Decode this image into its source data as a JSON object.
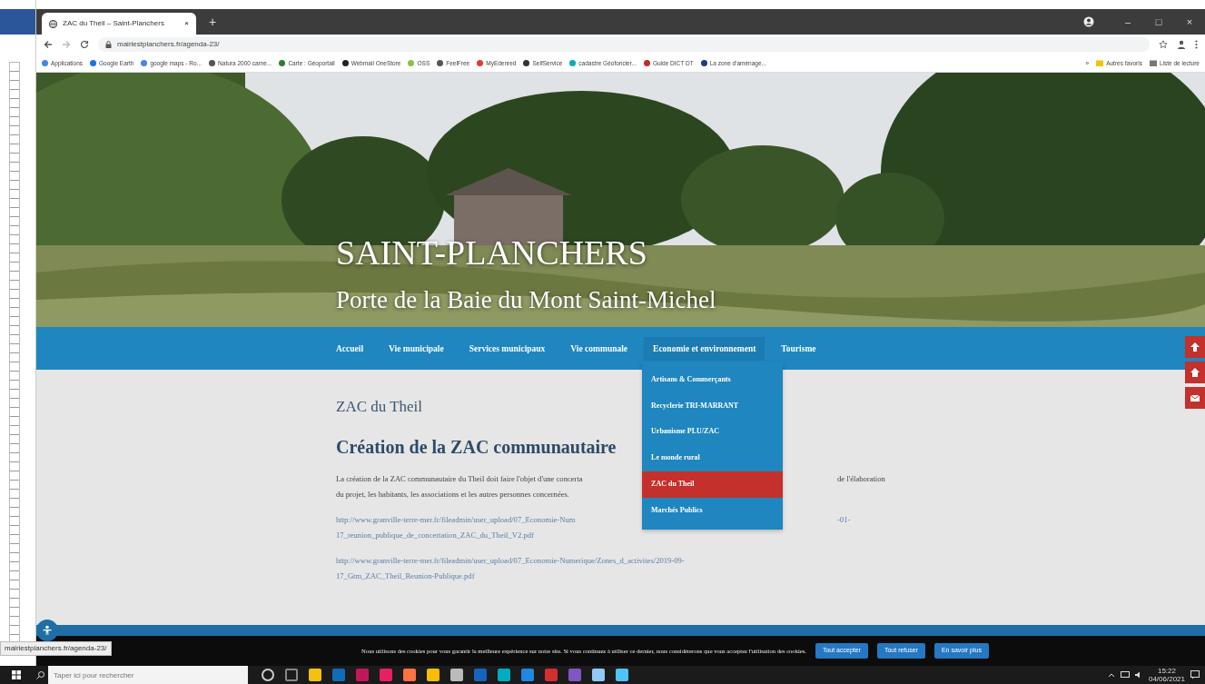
{
  "browser": {
    "tab_title": "ZAC du Theil – Saint-Planchers",
    "tab_close": "×",
    "new_tab": "+",
    "window_controls": [
      "–",
      "□",
      "×"
    ],
    "url": "mairiestplanchers.fr/agenda-23/",
    "bookmarks": [
      "Applications",
      "Google Earth",
      "google maps - Ro...",
      "Natura 2000 carne...",
      "Carte : Géoportail",
      "Webmail OneStore",
      "OSS",
      "FeelFree",
      "MyEdenred",
      "SelfService",
      "cadastre Géofoncier...",
      "Guide DICT DT",
      "La zone d'aménage..."
    ],
    "bookmarks_more": "»",
    "other_bookmarks": [
      "Autres favoris",
      "Liste de lecture"
    ]
  },
  "site": {
    "title": "SAINT-PLANCHERS",
    "subtitle": "Porte de la Baie du Mont Saint-Michel",
    "nav": [
      {
        "label": "Accueil",
        "expanded": false
      },
      {
        "label": "Vie municipale",
        "expanded": false
      },
      {
        "label": "Services municipaux",
        "expanded": false
      },
      {
        "label": "Vie communale",
        "expanded": false
      },
      {
        "label": "Economie et environnement",
        "expanded": true,
        "submenu": [
          {
            "label": "Artisans & Commerçants",
            "selected": false
          },
          {
            "label": "Recyclerie TRI-MARRANT",
            "selected": false
          },
          {
            "label": "Urbanisme PLU/ZAC",
            "selected": false
          },
          {
            "label": "Le monde rural",
            "selected": false
          },
          {
            "label": "ZAC du Theil",
            "selected": true
          },
          {
            "label": "Marchés Publics",
            "selected": false
          }
        ]
      },
      {
        "label": "Tourisme",
        "expanded": false
      }
    ],
    "page": {
      "title": "ZAC du Theil",
      "heading": "Création de la ZAC communautaire",
      "paragraph_lines": [
        [
          "La création de  la ZAC communautaire du Theil doit faire l'objet d'une concerta",
          "de l'élaboration"
        ],
        [
          "du projet, les habitants, les associations et les autres personnes concernées."
        ]
      ],
      "links": [
        {
          "lines": [
            [
              "http://www.granville-terre-mer.fr/fileadmin/user_upload/07_Economie-Num",
              "-01-"
            ],
            [
              "17_reunion_publique_de_concertation_ZAC_du_Theil_V2.pdf"
            ]
          ]
        },
        {
          "lines": [
            [
              "http://www.granville-terre-mer.fr/fileadmin/user_upload/07_Economie-Numerique/Zones_d_activites/2019-09-"
            ],
            [
              "17_Gtm_ZAC_Theil_Reunion-Publique.pdf"
            ]
          ]
        }
      ]
    }
  },
  "cookie_bar": {
    "text": "Nous utilisons des cookies pour vous garantir la meilleure expérience sur notre site. Si vous continuez à utiliser ce dernier, nous considérerons que vous acceptez l'utilisation des cookies.",
    "buttons": [
      "Tout accepter",
      "Tout refuser",
      "En savoir plus"
    ]
  },
  "status_url": "mairiestplanchers.fr/agenda-23/",
  "taskbar": {
    "search_placeholder": "Taper ici pour rechercher",
    "time": "15:22",
    "date": "04/06/2021"
  }
}
